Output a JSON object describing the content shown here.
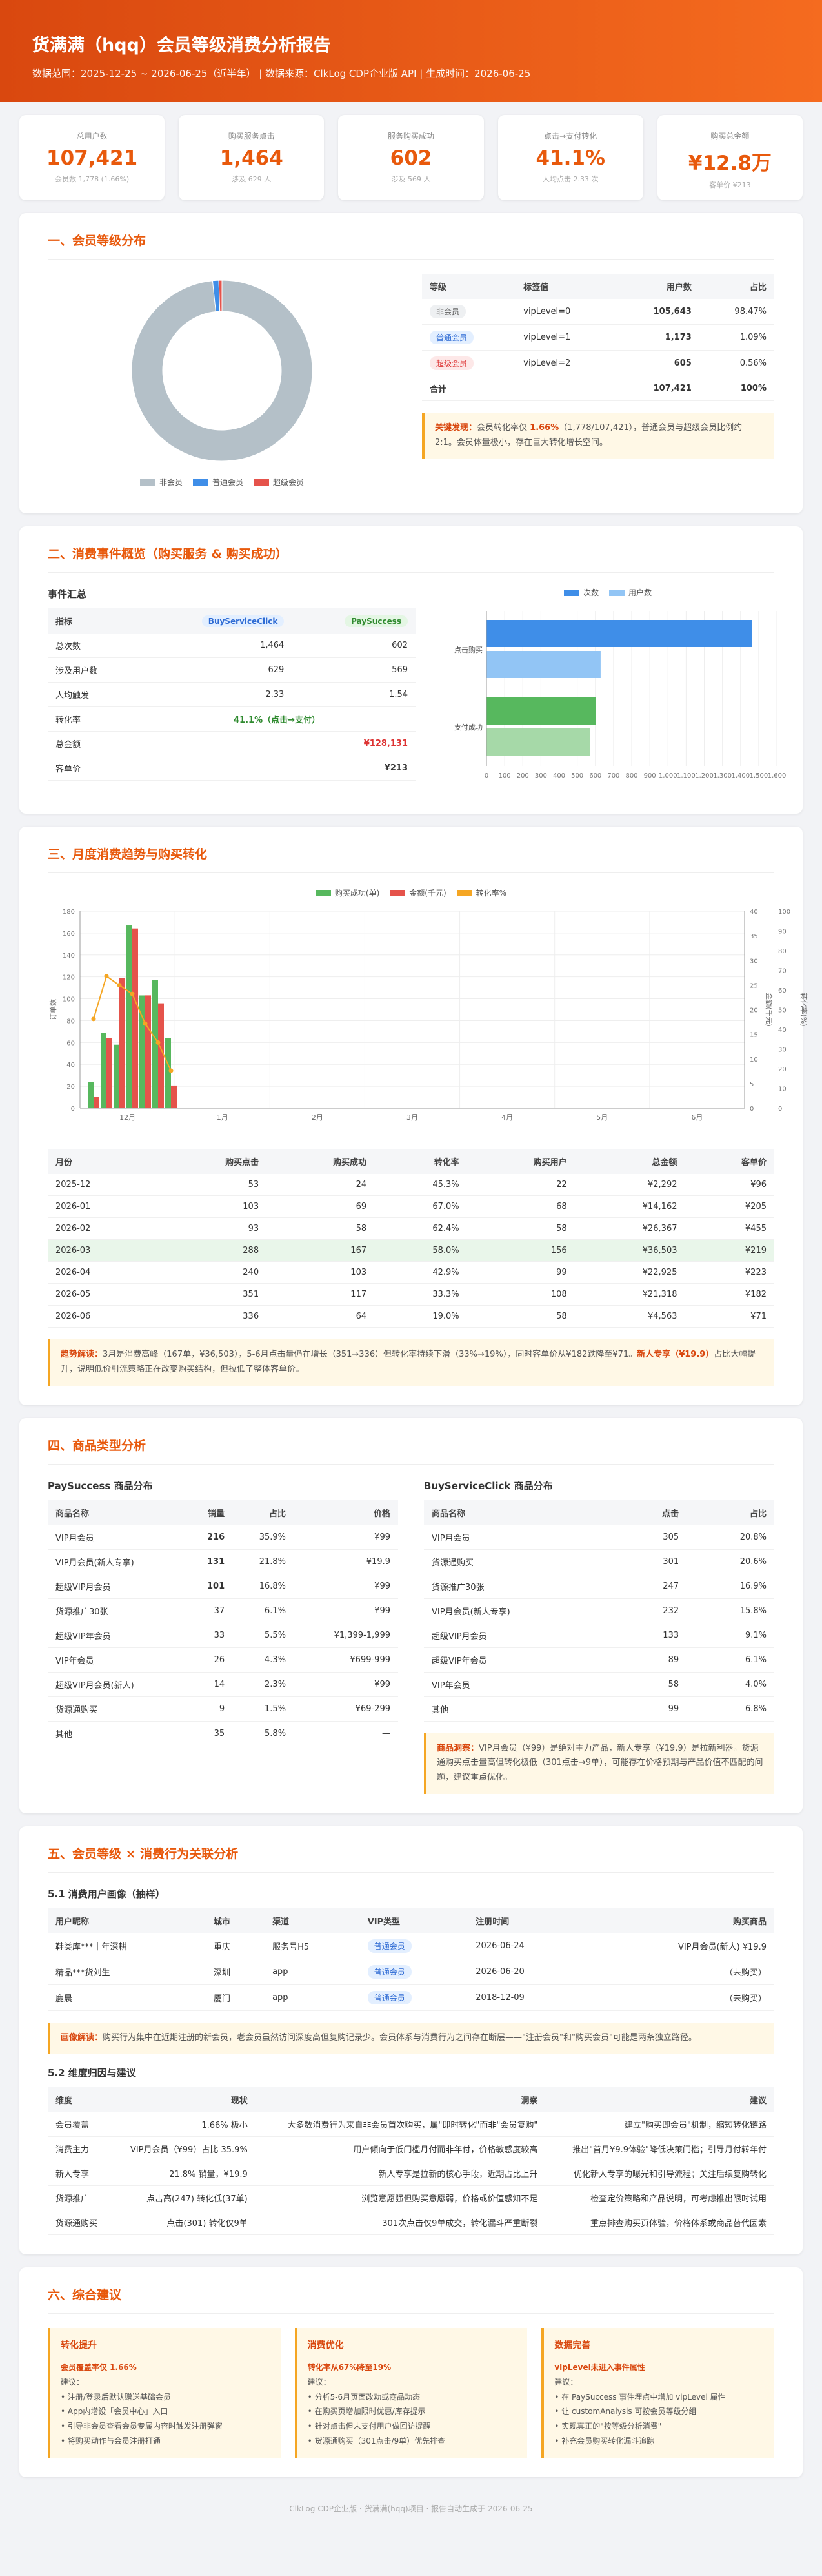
{
  "header": {
    "title": "货满满（hqq）会员等级消费分析报告",
    "meta": "数据范围：2025-12-25 ~ 2026-06-25（近半年） | 数据来源：ClkLog CDP企业版 API | 生成时间：2026-06-25"
  },
  "kpis": [
    {
      "label": "总用户数",
      "value": "107,421",
      "sub": "会员数 1,778 (1.66%)"
    },
    {
      "label": "购买服务点击",
      "value": "1,464",
      "sub": "涉及 629 人"
    },
    {
      "label": "服务购买成功",
      "value": "602",
      "sub": "涉及 569 人"
    },
    {
      "label": "点击→支付转化",
      "value": "41.1%",
      "sub": "人均点击 2.33 次"
    },
    {
      "label": "购买总金额",
      "value": "¥12.8万",
      "sub": "客单价 ¥213"
    }
  ],
  "s1": {
    "title": "一、会员等级分布",
    "pie": {
      "type": "pie",
      "categories": [
        "非会员",
        "普通会员",
        "超级会员"
      ],
      "values": [
        105643,
        1173,
        605
      ],
      "colors": [
        "#b4c0c8",
        "#3f8ee8",
        "#e5534b"
      ]
    },
    "headers": [
      "等级",
      "标签值",
      "用户数",
      "占比"
    ],
    "rows": [
      [
        "非会员",
        "vipLevel=0",
        "105,643",
        "98.47%"
      ],
      [
        "普通会员",
        "vipLevel=1",
        "1,173",
        "1.09%"
      ],
      [
        "超级会员",
        "vipLevel=2",
        "605",
        "0.56%"
      ]
    ],
    "total": [
      "合计",
      "",
      "107,421",
      "100%"
    ],
    "note_head": "关键发现：",
    "note_a": "会员转化率仅 ",
    "note_hl": "1.66%",
    "note_b": "（1,778/107,421），普通会员与超级会员比例约 2:1。会员体量极小，存在巨大转化增长空间。"
  },
  "s2": {
    "title": "二、消费事件概览（购买服务 & 购买成功）",
    "sub": "事件汇总",
    "headers": [
      "指标",
      "BuyServiceClick",
      "PaySuccess"
    ],
    "rows": [
      [
        "总次数",
        "1,464",
        "602"
      ],
      [
        "涉及用户数",
        "629",
        "569"
      ],
      [
        "人均触发",
        "2.33",
        "1.54"
      ]
    ],
    "conv_label": "转化率",
    "conv_value": "41.1%（点击→支付）",
    "amount_label": "总金额",
    "amount_value": "¥128,131",
    "aov_label": "客单价",
    "aov_value": "¥213",
    "chart": {
      "type": "bar",
      "categories": [
        "点击购买",
        "支付成功"
      ],
      "series": [
        {
          "name": "次数",
          "values": [
            1464,
            602
          ],
          "colors": [
            "#3f8ee8",
            "#57b85e"
          ]
        },
        {
          "name": "用户数",
          "values": [
            629,
            569
          ],
          "colors": [
            "#92c5f5",
            "#a6d9a8"
          ]
        }
      ],
      "xlim": [
        0,
        1600
      ],
      "xticks": [
        "0",
        "100",
        "200",
        "300",
        "400",
        "500",
        "600",
        "700",
        "800",
        "900",
        "1,000",
        "1,100",
        "1,200",
        "1,300",
        "1,400",
        "1,500",
        "1,600"
      ]
    }
  },
  "s3": {
    "title": "三、月度消费趋势与购买转化",
    "chart": {
      "type": "bar",
      "categories": [
        "12月",
        "1月",
        "2月",
        "3月",
        "4月",
        "5月",
        "6月"
      ],
      "series": [
        {
          "name": "购买成功(单)",
          "color": "#57b85e",
          "values": [
            24,
            69,
            58,
            167,
            103,
            117,
            64
          ]
        },
        {
          "name": "金额(千元)",
          "color": "#e5534b",
          "values": [
            2.3,
            14.2,
            26.4,
            36.5,
            22.9,
            21.3,
            4.6
          ]
        },
        {
          "name": "转化率%",
          "color": "#f5a623",
          "values": [
            45.3,
            67.0,
            62.4,
            58.0,
            42.9,
            33.3,
            19.0
          ]
        }
      ],
      "clicks": [
        53,
        103,
        93,
        288,
        240,
        351,
        336
      ],
      "ylabel": "订单数",
      "y2label": "金额(千元)",
      "y3label": "转化率(%)",
      "yticks": [
        "0",
        "20",
        "40",
        "60",
        "80",
        "100",
        "120",
        "140",
        "160",
        "180"
      ],
      "y2ticks": [
        "0",
        "5",
        "10",
        "15",
        "20",
        "25",
        "30",
        "35",
        "40"
      ],
      "y3ticks": [
        "0",
        "10",
        "20",
        "30",
        "40",
        "50",
        "60",
        "70",
        "80",
        "90",
        "100"
      ]
    },
    "headers": [
      "月份",
      "购买点击",
      "购买成功",
      "转化率",
      "购买用户",
      "总金额",
      "客单价"
    ],
    "rows": [
      [
        "2025-12",
        "53",
        "24",
        "45.3%",
        "22",
        "¥2,292",
        "¥96"
      ],
      [
        "2026-01",
        "103",
        "69",
        "67.0%",
        "68",
        "¥14,162",
        "¥205"
      ],
      [
        "2026-02",
        "93",
        "58",
        "62.4%",
        "58",
        "¥26,367",
        "¥455"
      ],
      [
        "2026-03",
        "288",
        "167",
        "58.0%",
        "156",
        "¥36,503",
        "¥219"
      ],
      [
        "2026-04",
        "240",
        "103",
        "42.9%",
        "99",
        "¥22,925",
        "¥223"
      ],
      [
        "2026-05",
        "351",
        "117",
        "33.3%",
        "108",
        "¥21,318",
        "¥182"
      ],
      [
        "2026-06",
        "336",
        "64",
        "19.0%",
        "58",
        "¥4,563",
        "¥71"
      ]
    ],
    "note_head": "趋势解读：",
    "note_a": "3月是消费高峰（167单，¥36,503），5-6月点击量仍在增长（351→336）但转化率持续下滑（33%→19%），同时客单价从¥182跌降至¥71。",
    "note_hl": "新人专享（¥19.9）",
    "note_b": "占比大幅提升，说明低价引流策略正在改变购买结构，但拉低了整体客单价。"
  },
  "s4": {
    "title": "四、商品类型分析",
    "left_title": "PaySuccess 商品分布",
    "left_headers": [
      "商品名称",
      "销量",
      "占比",
      "价格"
    ],
    "left_rows": [
      [
        "VIP月会员",
        "216",
        "35.9%",
        "¥99"
      ],
      [
        "VIP月会员(新人专享)",
        "131",
        "21.8%",
        "¥19.9"
      ],
      [
        "超级VIP月会员",
        "101",
        "16.8%",
        "¥99"
      ],
      [
        "货源推广30张",
        "37",
        "6.1%",
        "¥99"
      ],
      [
        "超级VIP年会员",
        "33",
        "5.5%",
        "¥1,399-1,999"
      ],
      [
        "VIP年会员",
        "26",
        "4.3%",
        "¥699-999"
      ],
      [
        "超级VIP月会员(新人)",
        "14",
        "2.3%",
        "¥99"
      ],
      [
        "货源通购买",
        "9",
        "1.5%",
        "¥69-299"
      ],
      [
        "其他",
        "35",
        "5.8%",
        "—"
      ]
    ],
    "right_title": "BuyServiceClick 商品分布",
    "right_headers": [
      "商品名称",
      "点击",
      "占比"
    ],
    "right_rows": [
      [
        "VIP月会员",
        "305",
        "20.8%"
      ],
      [
        "货源通购买",
        "301",
        "20.6%"
      ],
      [
        "货源推广30张",
        "247",
        "16.9%"
      ],
      [
        "VIP月会员(新人专享)",
        "232",
        "15.8%"
      ],
      [
        "超级VIP月会员",
        "133",
        "9.1%"
      ],
      [
        "超级VIP年会员",
        "89",
        "6.1%"
      ],
      [
        "VIP年会员",
        "58",
        "4.0%"
      ],
      [
        "其他",
        "99",
        "6.8%"
      ]
    ],
    "note_head": "商品洞察：",
    "note_text": "VIP月会员（¥99）是绝对主力产品，新人专享（¥19.9）是拉新利器。货源通购买点击量高但转化极低（301点击→9单），可能存在价格预期与产品价值不匹配的问题，建议重点优化。"
  },
  "s5": {
    "title": "五、会员等级 × 消费行为关联分析",
    "sub1": "5.1 消费用户画像（抽样）",
    "h1": [
      "用户昵称",
      "城市",
      "渠道",
      "VIP类型",
      "注册时间",
      "购买商品"
    ],
    "r1": [
      [
        "鞋类库***十年深耕",
        "重庆",
        "服务号H5",
        "普通会员",
        "2026-06-24",
        "VIP月会员(新人) ¥19.9"
      ],
      [
        "精品***货刘生",
        "深圳",
        "app",
        "普通会员",
        "2026-06-20",
        "—（未购买）"
      ],
      [
        "鹿晨",
        "厦门",
        "app",
        "普通会员",
        "2018-12-09",
        "—（未购买）"
      ]
    ],
    "note1_head": "画像解读：",
    "note1_text": "购买行为集中在近期注册的新会员，老会员虽然访问深度高但复购记录少。会员体系与消费行为之间存在断层——\"注册会员\"和\"购买会员\"可能是两条独立路径。",
    "sub2": "5.2 维度归因与建议",
    "h2": [
      "维度",
      "现状",
      "洞察",
      "建议"
    ],
    "r2": [
      [
        "会员覆盖",
        "1.66% 极小",
        "大多数消费行为来自非会员首次购买，属\"即时转化\"而非\"会员复购\"",
        "建立\"购买即会员\"机制，缩短转化链路"
      ],
      [
        "消费主力",
        "VIP月会员（¥99）占比 35.9%",
        "用户倾向于低门槛月付而非年付，价格敏感度较高",
        "推出\"首月¥9.9体验\"降低决策门槛；引导月付转年付"
      ],
      [
        "新人专享",
        "21.8% 销量，¥19.9",
        "新人专享是拉新的核心手段，近期占比上升",
        "优化新人专享的曝光和引导流程；关注后续复购转化"
      ],
      [
        "货源推广",
        "点击高(247) 转化低(37单)",
        "浏览意愿强但购买意愿弱，价格或价值感知不足",
        "检查定价策略和产品说明，可考虑推出限时试用"
      ],
      [
        "货源通购买",
        "点击(301) 转化仅9单",
        "301次点击仅9单成交，转化漏斗严重断裂",
        "重点排查购买页体验，价格体系或商品替代因素"
      ]
    ]
  },
  "s6": {
    "title": "六、综合建议",
    "cards": [
      {
        "head": "转化提升",
        "title": "会员覆盖率仅 1.66%",
        "lead": "建议：",
        "items": [
          "• 注册/登录后默认赠送基础会员",
          "• App内增设「会员中心」入口",
          "• 引导非会员查看会员专属内容时触发注册弹窗",
          "• 将购买动作与会员注册打通"
        ]
      },
      {
        "head": "消费优化",
        "title": "转化率从67%降至19%",
        "lead": "建议：",
        "items": [
          "• 分析5-6月页面改动或商品动态",
          "• 在购买页增加限时优惠/库存提示",
          "• 针对点击但未支付用户做回访提醒",
          "• 货源通购买（301点击/9单）优先排查"
        ]
      },
      {
        "head": "数据完善",
        "title": "vipLevel未进入事件属性",
        "lead": "建议：",
        "items": [
          "• 在 PaySuccess 事件埋点中增加 vipLevel 属性",
          "• 让 customAnalysis 可按会员等级分组",
          "• 实现真正的\"按等级分析消费\"",
          "• 补充会员购买转化漏斗追踪"
        ]
      }
    ]
  },
  "footer": "ClkLog CDP企业版 · 货满满(hqq)项目 · 报告自动生成于 2026-06-25"
}
